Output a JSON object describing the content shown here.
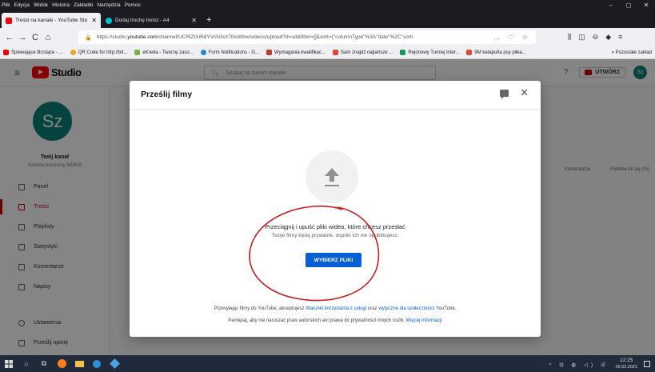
{
  "menubar": {
    "items": [
      "Plik",
      "Edycja",
      "Widok",
      "Historia",
      "Zakładki",
      "Narzędzia",
      "Pomoc"
    ],
    "controls": [
      "–",
      "◻",
      "✕"
    ]
  },
  "tabs": [
    {
      "label": "Treści na kanale - YouTube Stu",
      "close": "✕",
      "color": "#ff0000"
    },
    {
      "label": "Dodaj trochę treści - A4",
      "close": "✕",
      "color": "#00c4cc"
    }
  ],
  "new_tab": "+",
  "nav": {
    "back": "←",
    "forward": "→",
    "reload": "C",
    "home": "⌂",
    "url_prefix": "https://studio.",
    "url_domain": "youtube.com",
    "url_rest": "/channel/UCRlZtXiRdYVcN3vz7l3sWbw/videos/upload?d=ud&filter=[]&sort={\"columnType\"%3A\"date\"%2C\"sorti",
    "url_icons": "… ♡ ☆",
    "right_icons": [
      "⫼",
      "◫",
      "⊖",
      "◆",
      "≡"
    ]
  },
  "bookmarks": [
    {
      "label": "Śpiewające Brzdące - ...",
      "color": "#ff0000"
    },
    {
      "label": "QR Code for http://bit...",
      "color": "#f4a21f"
    },
    {
      "label": "eKreda - Tworzę zaso...",
      "color": "#7cb342"
    },
    {
      "label": "Form Notifications - G...",
      "color": "#1e88e5"
    },
    {
      "label": "Wymagania kwalifikac...",
      "color": "#c0392b"
    },
    {
      "label": "Sam znajdź najtańsze ...",
      "color": "#ea4335"
    },
    {
      "label": "Rejonowy Turniej inter...",
      "color": "#0f9d58"
    },
    {
      "label": "9M katapulta psy piłka...",
      "color": "#ea4335"
    }
  ],
  "bookmarks_overflow": "»  Pozostałe zakład",
  "studio": {
    "logo_text": "Studio",
    "search_placeholder": "Szukaj na swoim kanale",
    "create_label": "UTWÓRZ",
    "avatar_initials": "Sz",
    "channel_name": "Twój kanał",
    "channel_sub": "Szkolne konkursy MOKiS",
    "nav_items": [
      {
        "label": "Panel"
      },
      {
        "label": "Treści"
      },
      {
        "label": "Playlisty"
      },
      {
        "label": "Statystyki"
      },
      {
        "label": "Komentarze"
      },
      {
        "label": "Napisy"
      }
    ],
    "footer_items": [
      {
        "label": "Ustawienia"
      },
      {
        "label": "Prześlij opinię"
      }
    ],
    "columns": [
      "Komentarze",
      "Podoba mi się (%)"
    ]
  },
  "modal": {
    "title": "Prześlij filmy",
    "close": "✕",
    "main_message": "Przeciągnij i upuść pliki wideo, które chcesz przesłać",
    "sub_message": "Twoje filmy będą prywatne, dopóki ich nie opublikujesz.",
    "select_button": "WYBIERZ PLIKI",
    "terms_prefix": "Przesyłając filmy do YouTube, akceptujesz ",
    "terms_link1": "Warunki korzystania z usługi",
    "terms_mid": " oraz ",
    "terms_link2": "wytyczne dla społeczności",
    "terms_suffix": " YouTube.",
    "privacy_text": "Pamiętaj, aby nie naruszać praw autorskich ani prawa do prywatności innych osób. ",
    "privacy_link": "Więcej informacji"
  },
  "taskbar": {
    "tray_icons": "^ ⊡ ◍ ◁) ⓓ",
    "time": "12:25",
    "date": "26.03.2021"
  }
}
